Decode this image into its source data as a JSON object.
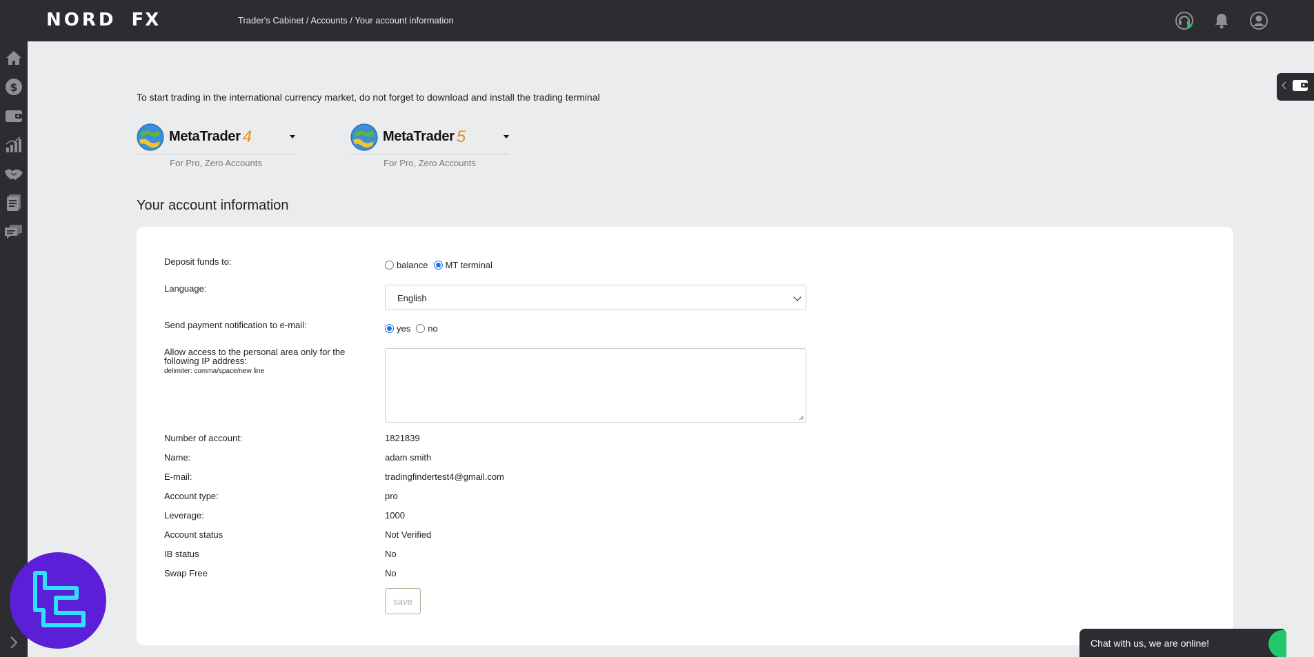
{
  "header": {
    "brand_left": "NORD",
    "brand_right": "FX",
    "breadcrumb": "Trader's Cabinet / Accounts / Your account information",
    "icons": [
      "support-headset-icon",
      "notification-bell-icon",
      "user-profile-icon"
    ]
  },
  "sidebar": {
    "items": [
      "home-icon",
      "dollar-icon",
      "wallet-icon",
      "statistics-icon",
      "partnership-handshake-icon",
      "documents-icon",
      "messages-icon"
    ],
    "expand_icon": "chevron-right-icon"
  },
  "intro": {
    "text": "To start trading in the international currency market, do not forget to download and install the trading terminal"
  },
  "terminals": [
    {
      "name": "MetaTrader",
      "version": "4",
      "subtitle": "For Pro, Zero Accounts"
    },
    {
      "name": "MetaTrader",
      "version": "5",
      "subtitle": "For Pro, Zero Accounts"
    }
  ],
  "page_title": "Your account information",
  "form": {
    "deposit_label": "Deposit funds to:",
    "deposit_options": [
      "balance",
      "MT terminal"
    ],
    "deposit_selected": "MT terminal",
    "language_label": "Language:",
    "language_value": "English",
    "notify_label": "Send payment notification to e-mail:",
    "notify_options": [
      "yes",
      "no"
    ],
    "notify_selected": "yes",
    "ip_label": "Allow access to the personal area only for the following IP address:",
    "ip_hint": "delimiter: comma/space/new line",
    "ip_value": "",
    "save_label": "save"
  },
  "account": {
    "rows": [
      {
        "label": "Number of account:",
        "value": "1821839"
      },
      {
        "label": "Name:",
        "value": "adam smith"
      },
      {
        "label": "E-mail:",
        "value": "tradingfindertest4@gmail.com"
      },
      {
        "label": "Account type:",
        "value": "pro"
      },
      {
        "label": "Leverage:",
        "value": "1000"
      },
      {
        "label": "Account status",
        "value": "Not Verified"
      },
      {
        "label": "IB status",
        "value": "No"
      },
      {
        "label": "Swap Free",
        "value": "No"
      }
    ]
  },
  "chat": {
    "text": "Chat with us, we are online!"
  },
  "colors": {
    "dark_bar": "#2b2d31",
    "page_bg": "#ebecee",
    "card_bg": "#ffffff",
    "accent_blue": "#1a73e8",
    "mt_orange": "#f08a1c",
    "chat_green": "#21c96b",
    "badge_purple": "#5a1fd6",
    "badge_cyan": "#2fe0ff"
  }
}
